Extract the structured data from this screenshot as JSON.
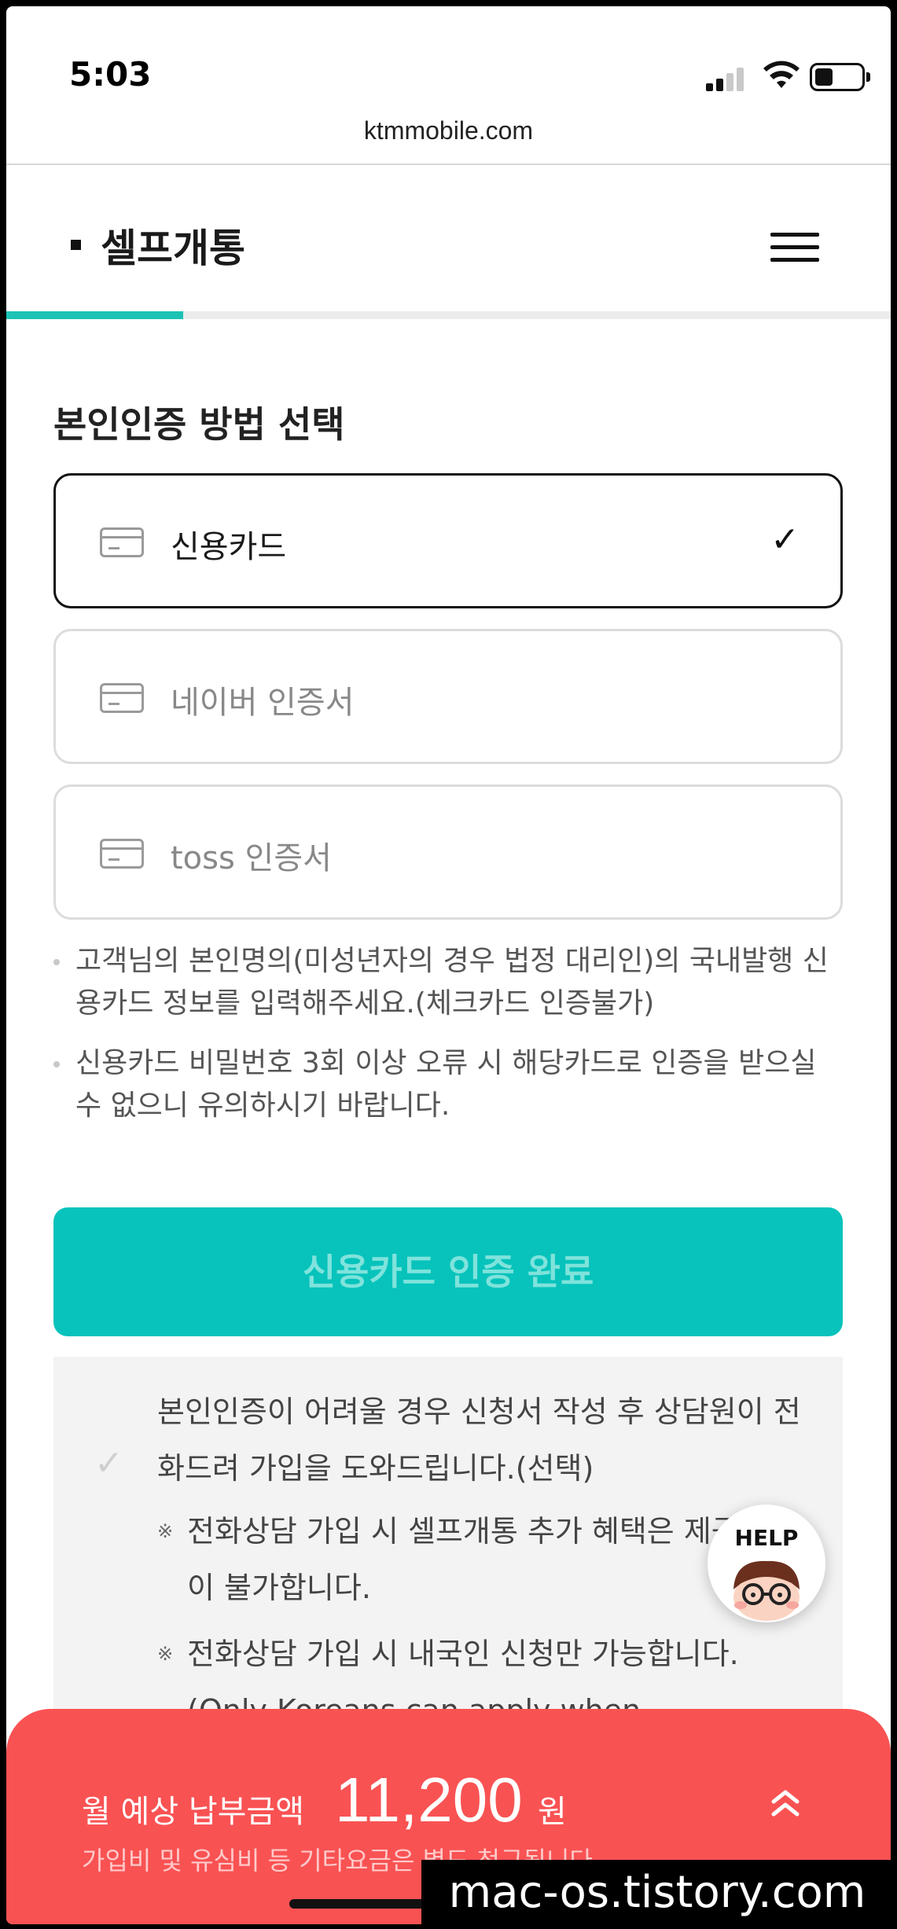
{
  "status_bar": {
    "time": "5:03"
  },
  "browser": {
    "url": "ktmmobile.com"
  },
  "header": {
    "title": "셀프개통",
    "progress_percent": 20
  },
  "auth": {
    "section_title": "본인인증 방법 선택",
    "options": [
      {
        "label": "신용카드",
        "selected": true,
        "icon": "credit-card-icon"
      },
      {
        "label": "네이버 인증서",
        "selected": false,
        "icon": "credit-card-icon"
      },
      {
        "label": "toss 인증서",
        "selected": false,
        "icon": "credit-card-icon"
      }
    ],
    "notes": [
      "고객님의 본인명의(미성년자의 경우 법정 대리인)의 국내발행 신용카드 정보를 입력해주세요.(체크카드 인증불가)",
      "신용카드 비밀번호 3회 이상 오류 시 해당카드로 인증을 받으실 수 없으니 유의하시기 바랍니다."
    ],
    "confirm_label": "신용카드 인증 완료"
  },
  "help_box": {
    "main_text": "본인인증이 어려울 경우 신청서 작성 후 상담원이 전화드려 가입을 도와드립니다.(선택)",
    "sub_mark": "※",
    "sub_items": [
      "전화상담 가입 시 셀프개통 추가 혜택은 제공이 불가합니다.",
      "전화상담 가입 시 내국인 신청만 가능합니다.",
      "(Only Koreans can apply when signing up"
    ]
  },
  "help_fab": {
    "label": "HELP"
  },
  "bottom_bar": {
    "fee_label": "월 예상 납부금액",
    "amount": "11,200",
    "unit": "원",
    "sub_note": "가입비 및 유심비 등 기타요금은 별도 청구됩니다."
  },
  "watermark": "mac-os.tistory.com",
  "colors": {
    "accent": "#07c3bb",
    "progress": "#1cc3b5",
    "bottom_bar": "#f95253"
  }
}
